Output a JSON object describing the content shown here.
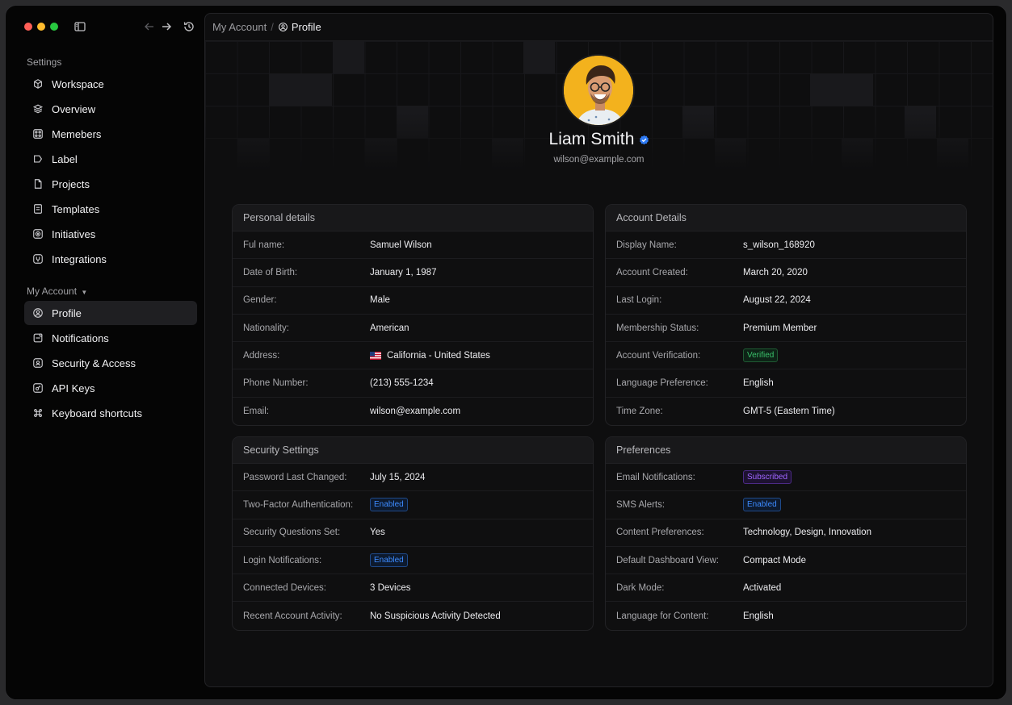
{
  "sidebar": {
    "settings_title": "Settings",
    "settings_items": [
      {
        "label": "Workspace",
        "icon": "cube-icon"
      },
      {
        "label": "Overview",
        "icon": "layers-icon"
      },
      {
        "label": "Memebers",
        "icon": "users-icon"
      },
      {
        "label": "Label",
        "icon": "tag-icon"
      },
      {
        "label": "Projects",
        "icon": "file-icon"
      },
      {
        "label": "Templates",
        "icon": "template-icon"
      },
      {
        "label": "Initiatives",
        "icon": "target-icon"
      },
      {
        "label": "Integrations",
        "icon": "plug-icon"
      }
    ],
    "account_title": "My Account",
    "account_items": [
      {
        "label": "Profile",
        "icon": "user-circle-icon",
        "active": true
      },
      {
        "label": "Notifications",
        "icon": "bell-icon"
      },
      {
        "label": "Security & Access",
        "icon": "shield-icon"
      },
      {
        "label": "API Keys",
        "icon": "key-icon"
      },
      {
        "label": "Keyboard shortcuts",
        "icon": "command-icon"
      }
    ]
  },
  "breadcrumb": {
    "parent": "My Account",
    "separator": "/",
    "current": "Profile"
  },
  "profile": {
    "name": "Liam Smith",
    "email": "wilson@example.com"
  },
  "cards": {
    "personal": {
      "title": "Personal details",
      "rows": [
        {
          "label": "Ful name:",
          "value": "Samuel Wilson"
        },
        {
          "label": "Date of Birth:",
          "value": "January 1, 1987"
        },
        {
          "label": "Gender:",
          "value": "Male"
        },
        {
          "label": "Nationality:",
          "value": "American"
        },
        {
          "label": "Address:",
          "value": "California - United States"
        },
        {
          "label": "Phone Number:",
          "value": "(213) 555-1234"
        },
        {
          "label": "Email:",
          "value": "wilson@example.com"
        }
      ]
    },
    "account": {
      "title": "Account Details",
      "rows": [
        {
          "label": "Display Name:",
          "value": "s_wilson_168920"
        },
        {
          "label": "Account Created:",
          "value": "March 20, 2020"
        },
        {
          "label": "Last Login:",
          "value": "August 22, 2024"
        },
        {
          "label": "Membership Status:",
          "value": "Premium Member"
        },
        {
          "label": "Account Verification:",
          "value": "Verified"
        },
        {
          "label": "Language Preference:",
          "value": "English"
        },
        {
          "label": "Time Zone:",
          "value": "GMT-5 (Eastern Time)"
        }
      ]
    },
    "security": {
      "title": "Security Settings",
      "rows": [
        {
          "label": "Password Last Changed:",
          "value": "July 15, 2024"
        },
        {
          "label": "Two-Factor Authentication:",
          "value": "Enabled"
        },
        {
          "label": "Security Questions Set:",
          "value": "Yes"
        },
        {
          "label": "Login Notifications:",
          "value": "Enabled"
        },
        {
          "label": "Connected Devices:",
          "value": "3 Devices"
        },
        {
          "label": "Recent Account Activity:",
          "value": "No Suspicious Activity Detected"
        }
      ]
    },
    "preferences": {
      "title": "Preferences",
      "rows": [
        {
          "label": "Email Notifications:",
          "value": "Subscribed"
        },
        {
          "label": "SMS Alerts:",
          "value": "Enabled"
        },
        {
          "label": "Content Preferences:",
          "value": "Technology, Design, Innovation"
        },
        {
          "label": "Default Dashboard View:",
          "value": "Compact Mode"
        },
        {
          "label": "Dark Mode:",
          "value": "Activated"
        },
        {
          "label": "Language for Content:",
          "value": "English"
        }
      ]
    }
  },
  "colors": {
    "badge_blue": "#3d8bff",
    "badge_green": "#3ac26b",
    "badge_purple": "#a066ff",
    "verified_blue": "#2f7bf5",
    "avatar_bg": "#f3b21d"
  }
}
